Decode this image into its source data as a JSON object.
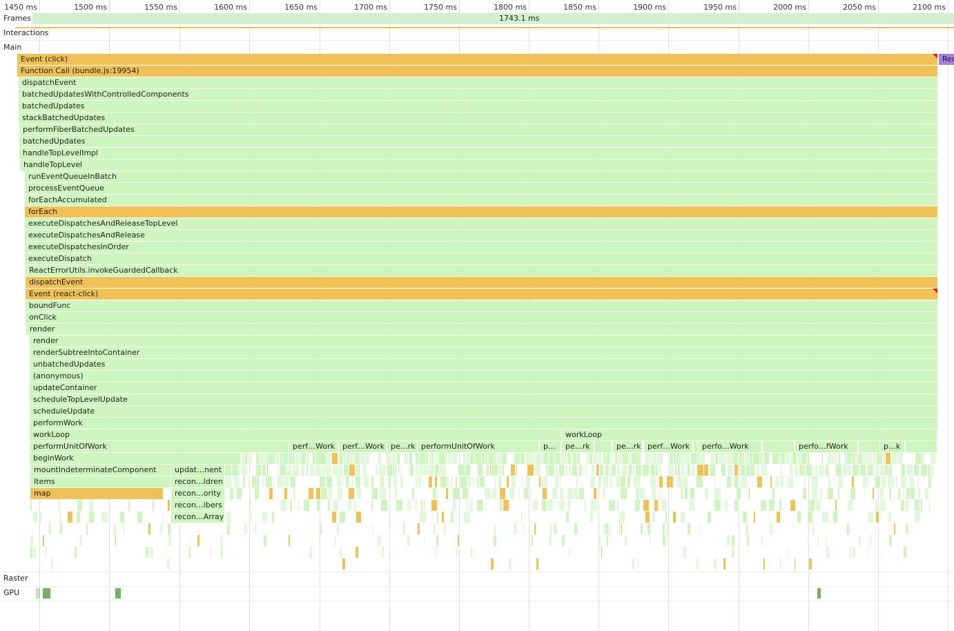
{
  "ruler": {
    "ticks": [
      "1450 ms",
      "1500 ms",
      "1550 ms",
      "1600 ms",
      "1650 ms",
      "1700 ms",
      "1750 ms",
      "1800 ms",
      "1850 ms",
      "1900 ms",
      "1950 ms",
      "2000 ms",
      "2050 ms",
      "2100 ms"
    ]
  },
  "tracks": {
    "frames": "Frames",
    "frame_duration": "1743.1 ms",
    "interactions": "Interactions",
    "main": "Main",
    "raster": "Raster",
    "gpu": "GPU"
  },
  "flame": {
    "rows": [
      {
        "label": "Event (click)",
        "kind": "o"
      },
      {
        "label": "Function Call (bundle.js:19954)",
        "kind": "o"
      },
      {
        "label": "dispatchEvent",
        "kind": "g"
      },
      {
        "label": "batchedUpdatesWithControlledComponents",
        "kind": "g"
      },
      {
        "label": "batchedUpdates",
        "kind": "g"
      },
      {
        "label": "stackBatchedUpdates",
        "kind": "g"
      },
      {
        "label": "performFiberBatchedUpdates",
        "kind": "g"
      },
      {
        "label": "batchedUpdates",
        "kind": "g"
      },
      {
        "label": "handleTopLevelImpl",
        "kind": "g"
      },
      {
        "label": "handleTopLevel",
        "kind": "g"
      },
      {
        "label": "runEventQueueInBatch",
        "kind": "g"
      },
      {
        "label": "processEventQueue",
        "kind": "g"
      },
      {
        "label": "forEachAccumulated",
        "kind": "g"
      },
      {
        "label": "forEach",
        "kind": "o"
      },
      {
        "label": "executeDispatchesAndReleaseTopLevel",
        "kind": "g"
      },
      {
        "label": "executeDispatchesAndRelease",
        "kind": "g"
      },
      {
        "label": "executeDispatchesInOrder",
        "kind": "g"
      },
      {
        "label": "executeDispatch",
        "kind": "g"
      },
      {
        "label": "ReactErrorUtils.invokeGuardedCallback",
        "kind": "g"
      },
      {
        "label": "dispatchEvent",
        "kind": "o"
      },
      {
        "label": "Event (react-click)",
        "kind": "o"
      },
      {
        "label": "boundFunc",
        "kind": "g"
      },
      {
        "label": "onClick",
        "kind": "g"
      },
      {
        "label": "render",
        "kind": "g"
      },
      {
        "label": "render",
        "kind": "g"
      },
      {
        "label": "renderSubtreeIntoContainer",
        "kind": "g"
      },
      {
        "label": "unbatchedUpdates",
        "kind": "g"
      },
      {
        "label": "(anonymous)",
        "kind": "g"
      },
      {
        "label": "updateContainer",
        "kind": "g"
      },
      {
        "label": "scheduleTopLevelUpdate",
        "kind": "g"
      },
      {
        "label": "scheduleUpdate",
        "kind": "g"
      },
      {
        "label": "performWork",
        "kind": "g"
      }
    ],
    "extra": [
      {
        "label": "Rec",
        "kind": "p"
      },
      {
        "label": "workLoop",
        "kind": "g"
      },
      {
        "label": "workLoop",
        "kind": "g"
      },
      {
        "label": "performUnitOfWork",
        "kind": "g"
      },
      {
        "label": "perf…Work",
        "kind": "g"
      },
      {
        "label": "perf…Work",
        "kind": "g"
      },
      {
        "label": "pe…rk",
        "kind": "g"
      },
      {
        "label": "performUnitOfWork",
        "kind": "g"
      },
      {
        "label": "p…",
        "kind": "g"
      },
      {
        "label": "pe…rk",
        "kind": "g"
      },
      {
        "label": "pe…rk",
        "kind": "g"
      },
      {
        "label": "perf…Work",
        "kind": "g"
      },
      {
        "label": "perfo…Work",
        "kind": "g"
      },
      {
        "label": "perfo…fWork",
        "kind": "g"
      },
      {
        "label": "p…k",
        "kind": "g"
      },
      {
        "label": "beginWork",
        "kind": "g"
      },
      {
        "label": "mountIndeterminateComponent",
        "kind": "g"
      },
      {
        "label": "updat…nent",
        "kind": "g"
      },
      {
        "label": "Items",
        "kind": "g"
      },
      {
        "label": "recon…ldren",
        "kind": "g"
      },
      {
        "label": "map",
        "kind": "o"
      },
      {
        "label": "recon…ority",
        "kind": "g"
      },
      {
        "label": "recon…ibers",
        "kind": "g"
      },
      {
        "label": "recon…Array",
        "kind": "g"
      }
    ]
  },
  "colors": {
    "green": "#cdf5bd",
    "orange": "#f0c155",
    "purple": "#a57ee0",
    "gpu": "#72b063",
    "warning": "#e31b1b"
  }
}
